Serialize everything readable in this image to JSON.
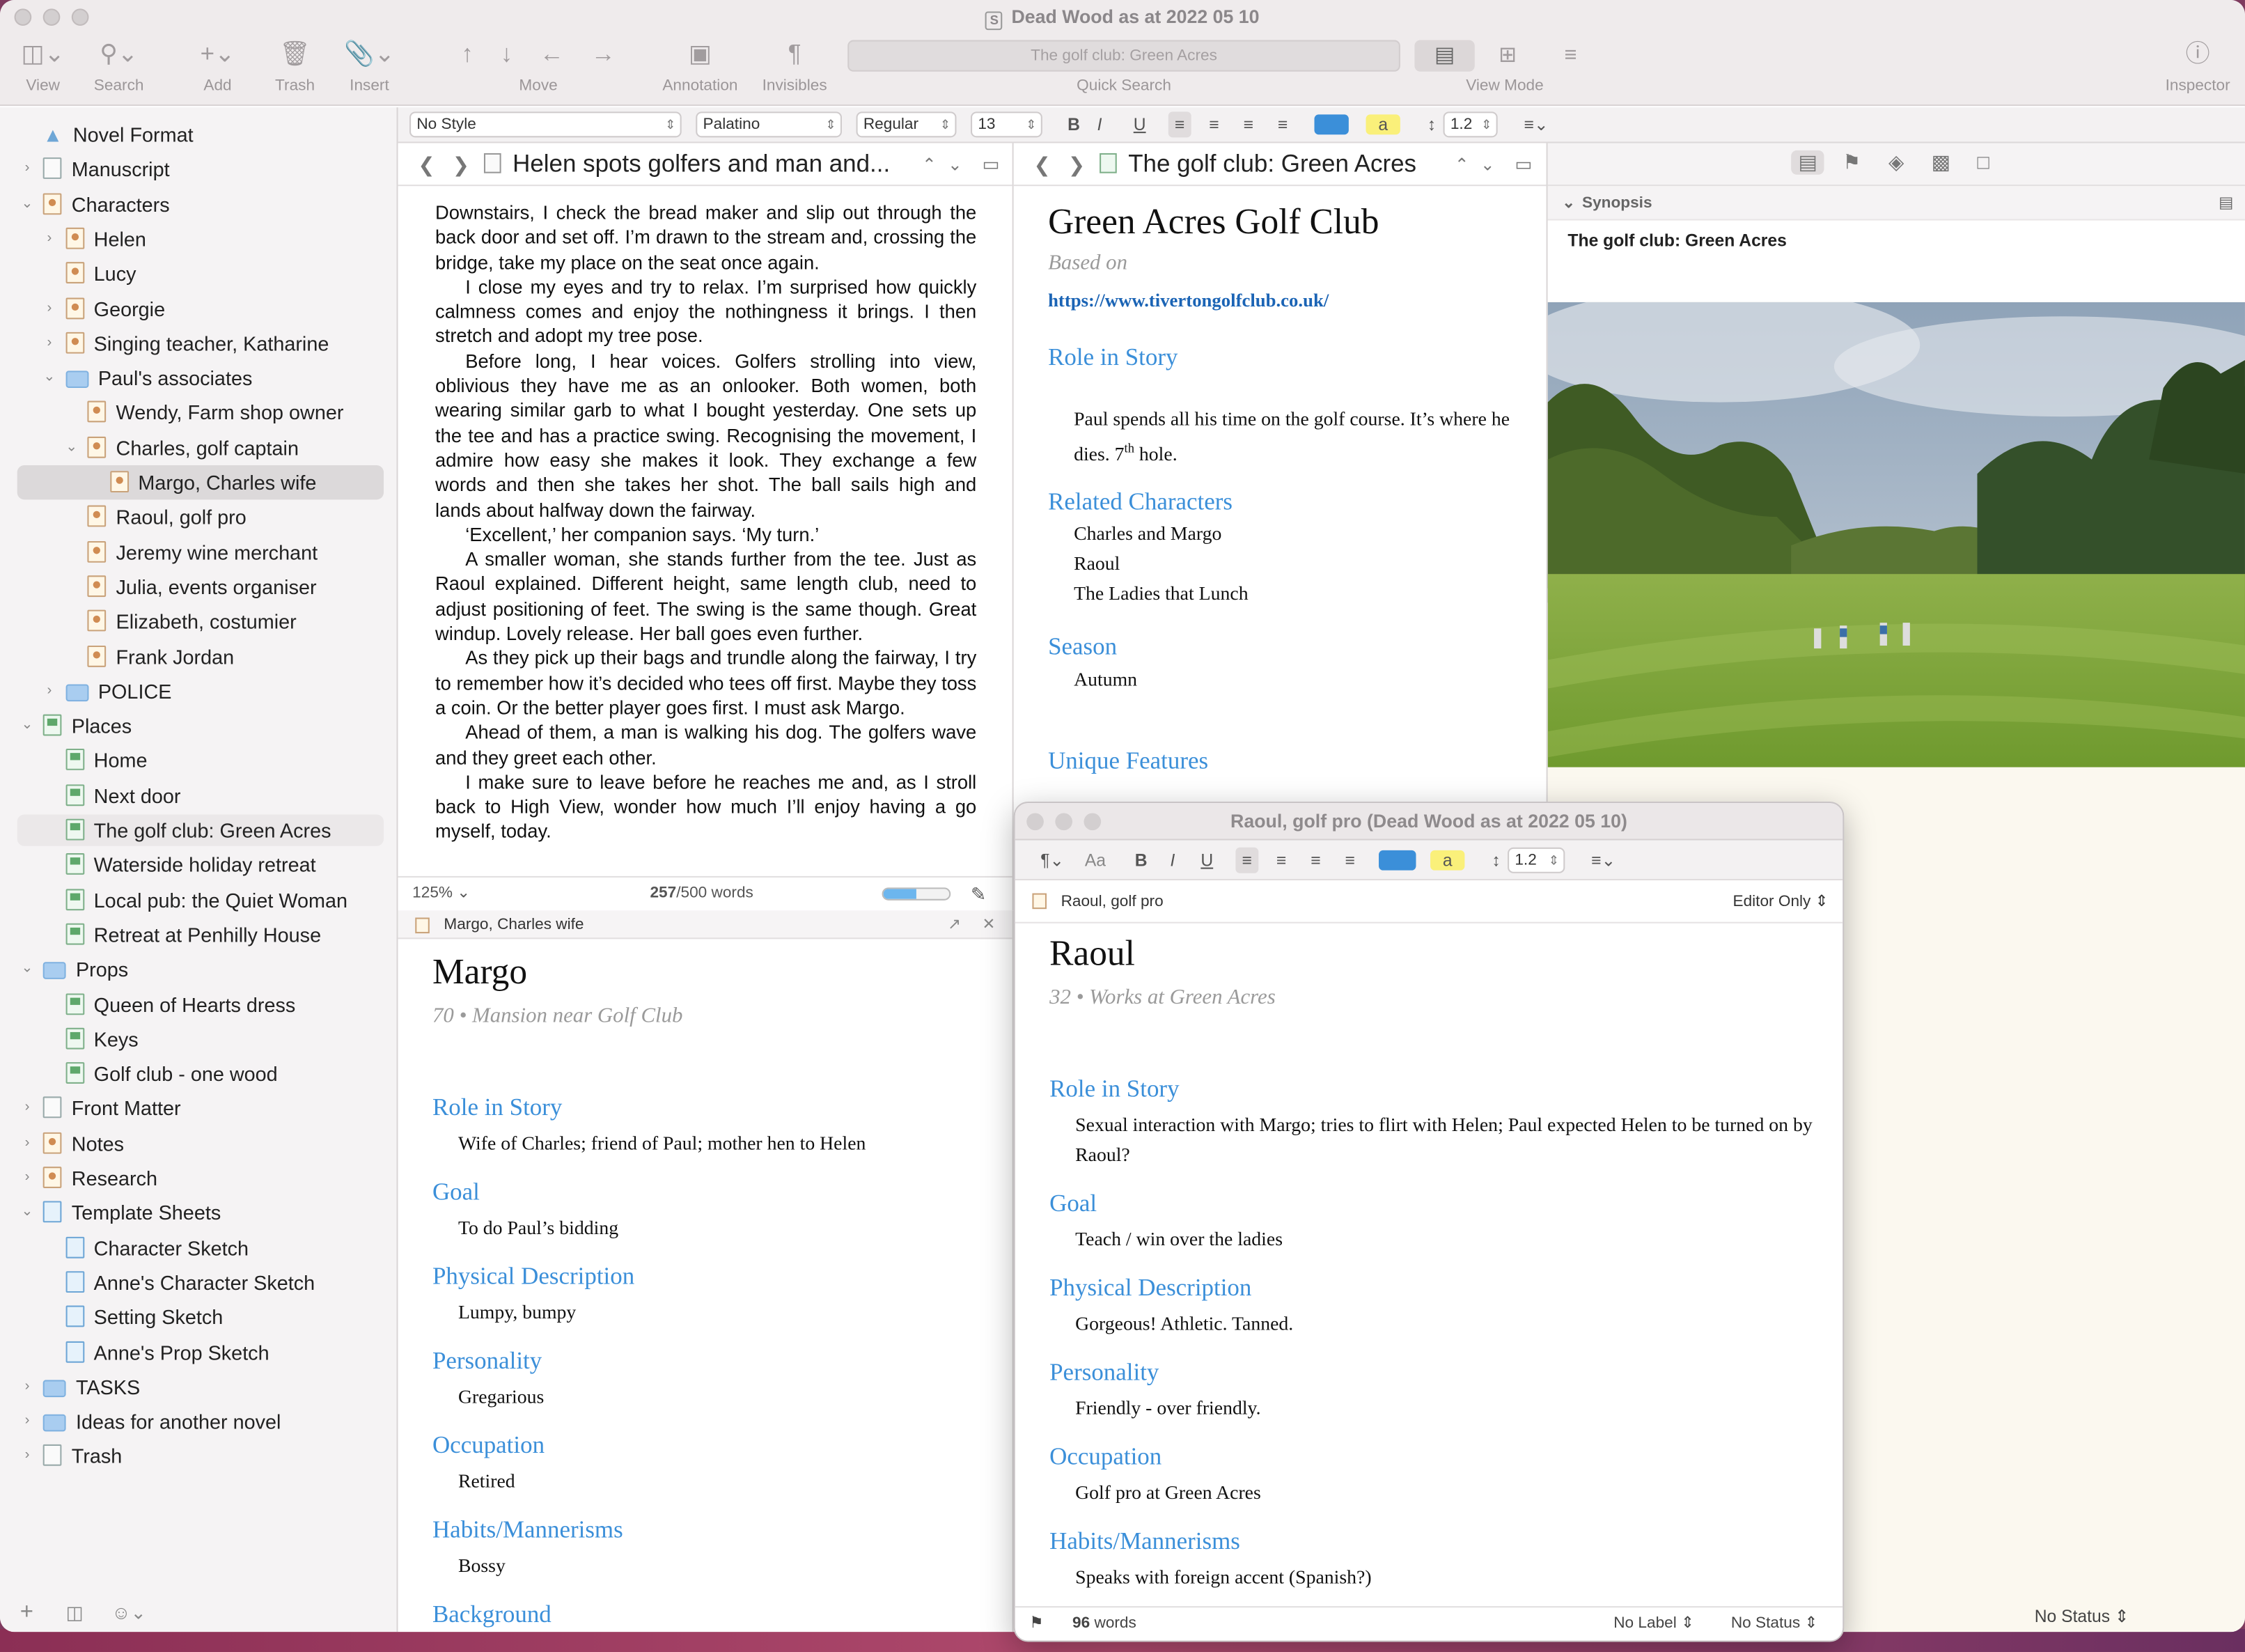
{
  "window": {
    "title": "Dead Wood as at 2022 05 10"
  },
  "toolbar": {
    "view": "View",
    "search": "Search",
    "add": "Add",
    "trash": "Trash",
    "insert": "Insert",
    "move": "Move",
    "annotation": "Annotation",
    "invisibles": "Invisibles",
    "quick_search_label": "Quick Search",
    "quick_search_value": "The golf club: Green Acres",
    "view_mode": "View Mode",
    "inspector": "Inspector"
  },
  "format_bar": {
    "style": "No Style",
    "font": "Palatino",
    "weight": "Regular",
    "size": "13",
    "line_spacing": "1.2",
    "bold": "B",
    "italic": "I",
    "underline": "U",
    "highlight": "a"
  },
  "binder": {
    "items": [
      {
        "label": "Novel Format"
      },
      {
        "label": "Manuscript"
      },
      {
        "label": "Characters"
      },
      {
        "label": "Helen"
      },
      {
        "label": "Lucy"
      },
      {
        "label": "Georgie"
      },
      {
        "label": "Singing teacher, Katharine"
      },
      {
        "label": "Paul's associates"
      },
      {
        "label": "Wendy, Farm shop owner"
      },
      {
        "label": "Charles, golf captain"
      },
      {
        "label": "Margo, Charles wife"
      },
      {
        "label": "Raoul, golf pro"
      },
      {
        "label": "Jeremy wine merchant"
      },
      {
        "label": "Julia, events organiser"
      },
      {
        "label": "Elizabeth, costumier"
      },
      {
        "label": "Frank Jordan"
      },
      {
        "label": "POLICE"
      },
      {
        "label": "Places"
      },
      {
        "label": "Home"
      },
      {
        "label": "Next door"
      },
      {
        "label": "The golf club: Green Acres"
      },
      {
        "label": "Waterside holiday retreat"
      },
      {
        "label": "Local pub: the Quiet Woman"
      },
      {
        "label": "Retreat at Penhilly House"
      },
      {
        "label": "Props"
      },
      {
        "label": "Queen of Hearts dress"
      },
      {
        "label": "Keys"
      },
      {
        "label": "Golf club - one wood"
      },
      {
        "label": "Front Matter"
      },
      {
        "label": "Notes"
      },
      {
        "label": "Research"
      },
      {
        "label": "Template Sheets"
      },
      {
        "label": "Character Sketch"
      },
      {
        "label": "Anne's Character Sketch"
      },
      {
        "label": "Setting Sketch"
      },
      {
        "label": "Anne's Prop Sketch"
      },
      {
        "label": "TASKS"
      },
      {
        "label": "Ideas for another novel"
      },
      {
        "label": "Trash"
      }
    ]
  },
  "editor_a": {
    "title": "Helen spots golfers and man and...",
    "paragraphs": [
      "Downstairs, I check the bread maker and slip out through the back door and set off. I’m drawn to the stream and, crossing the bridge, take my place on the seat once again.",
      "I close my eyes and try to relax. I’m surprised how quickly calmness comes and enjoy the nothingness it brings. I then stretch and adopt my tree pose.",
      "Before long, I hear voices. Golfers strolling into view, oblivious they have me as an onlooker. Both women, both wearing similar garb to what I bought yesterday. One sets up the tee and has a practice swing. Recognising the movement, I admire how easy she makes it look. They exchange a few words and then she takes her shot. The ball sails high and lands about halfway down the fairway.",
      "‘Excellent,’ her companion says. ‘My turn.’",
      "A smaller woman, she stands further from the tee. Just as Raoul explained. Different height, same length club, need to adjust positioning of feet. The swing is the same though. Great windup. Lovely release. Her ball goes even further.",
      "As they pick up their bags and trundle along the fairway, I try to remember how it’s decided who tees off first. Maybe they toss a coin. Or the better player goes first. I must ask Margo.",
      "Ahead of them, a man is walking his dog. The golfers wave and they greet each other.",
      "I make sure to leave before he reaches me and, as I stroll back to High View, wonder how much I’ll enjoy having a go myself, today."
    ],
    "zoom": "125%",
    "word_count": "257",
    "word_target": "/500 words",
    "progress": 0.51
  },
  "editor_b": {
    "doc_title": "Margo, Charles wife",
    "heading": "Margo",
    "subtitle": "70 • Mansion near Golf Club",
    "sections": [
      {
        "head": "Role in Story",
        "value": "Wife of Charles; friend of Paul; mother hen to Helen"
      },
      {
        "head": "Goal",
        "value": "To do Paul’s bidding"
      },
      {
        "head": "Physical Description",
        "value": "Lumpy, bumpy"
      },
      {
        "head": "Personality",
        "value": "Gregarious"
      },
      {
        "head": "Occupation",
        "value": "Retired"
      },
      {
        "head": "Habits/Mannerisms",
        "value": "Bossy"
      },
      {
        "head": "Background",
        "value": ""
      }
    ]
  },
  "editor_c": {
    "title": "The golf club: Green Acres",
    "heading": "Green Acres Golf Club",
    "based_on": "Based on",
    "link": "https://www.tivertongolfclub.co.uk/",
    "role_head": "Role in Story",
    "role_text_1": "Paul spends all his time on the golf course. It’s where he dies. 7",
    "role_sup": "th",
    "role_text_2": " hole.",
    "related_head": "Related Characters",
    "related": [
      "Charles and Margo",
      "Raoul",
      "The Ladies that Lunch"
    ],
    "season_head": "Season",
    "season": "Autumn",
    "unique_head": "Unique Features"
  },
  "inspector": {
    "synopsis_label": "Synopsis",
    "synopsis_text": "The golf club: Green Acres",
    "status": "No Status"
  },
  "floating": {
    "title": "Raoul, golf pro (Dead Wood as at 2022 05 10)",
    "doc_name": "Raoul, golf pro",
    "mode": "Editor Only",
    "font_btn": "Aa",
    "line_spacing": "1.2",
    "heading": "Raoul",
    "subtitle": "32 • Works at Green Acres",
    "sections": [
      {
        "head": "Role in Story",
        "value": "Sexual interaction with Margo; tries to flirt with Helen; Paul expected Helen to be turned on by Raoul?"
      },
      {
        "head": "Goal",
        "value": "Teach / win over the ladies"
      },
      {
        "head": "Physical Description",
        "value": "Gorgeous! Athletic. Tanned."
      },
      {
        "head": "Personality",
        "value": "Friendly - over friendly."
      },
      {
        "head": "Occupation",
        "value": "Golf pro at Green Acres"
      },
      {
        "head": "Habits/Mannerisms",
        "value": "Speaks with foreign accent (Spanish?)"
      }
    ],
    "word_count": "96",
    "words_label": " words",
    "label": "No Label",
    "status": "No Status"
  },
  "colors": {
    "accent_blue": "#3b8fd9",
    "link": "#1b64b5",
    "selection": "#dcd9da"
  }
}
